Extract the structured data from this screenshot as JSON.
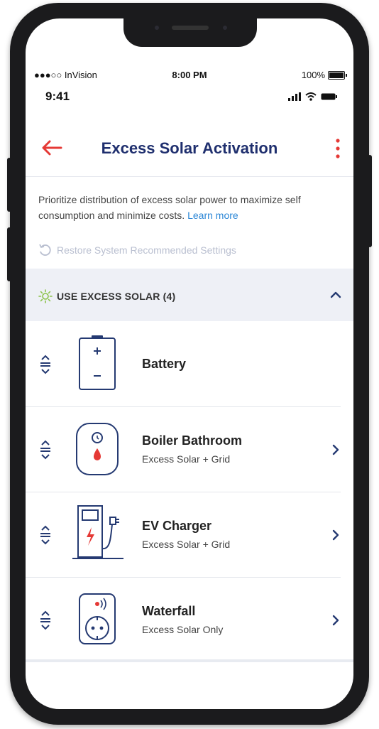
{
  "statusbar": {
    "carrier": "●●●○○ InVision",
    "time_top": "8:00 PM",
    "battery_pct": "100%",
    "device_time": "9:41"
  },
  "header": {
    "title": "Excess Solar Activation"
  },
  "intro": {
    "text": "Prioritize distribution of excess solar power to maximize self consumption and minimize costs.",
    "learn_more": "Learn more"
  },
  "restore": {
    "label": "Restore System Recommended Settings"
  },
  "section": {
    "label": "USE EXCESS SOLAR (4)"
  },
  "devices": [
    {
      "name": "Battery",
      "mode": "",
      "icon": "battery-icon"
    },
    {
      "name": "Boiler Bathroom",
      "mode": "Excess Solar + Grid",
      "icon": "boiler-icon"
    },
    {
      "name": "EV Charger",
      "mode": "Excess Solar + Grid",
      "icon": "ev-charger-icon"
    },
    {
      "name": "Waterfall",
      "mode": "Excess Solar Only",
      "icon": "smart-plug-icon"
    }
  ],
  "colors": {
    "accent": "#e53935",
    "title": "#1f2f6e",
    "icon": "#253a72",
    "link": "#2a86d6",
    "sun": "#8bc34a"
  }
}
